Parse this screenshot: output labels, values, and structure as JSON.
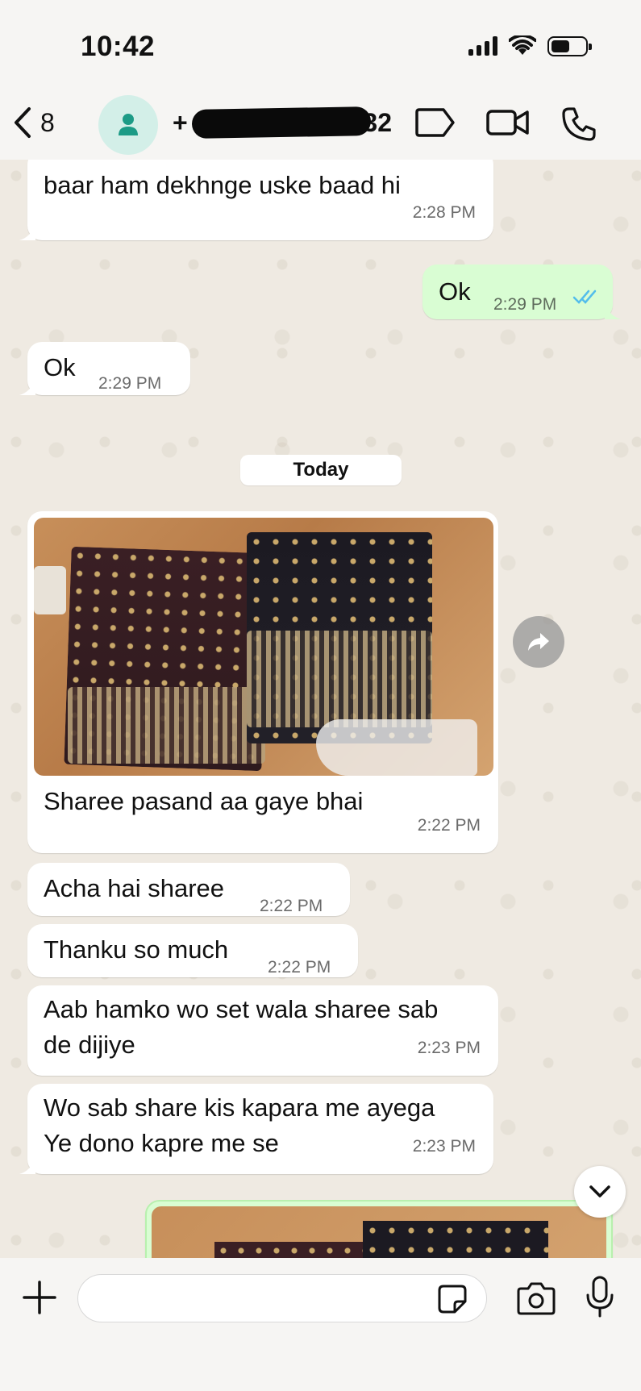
{
  "status": {
    "time": "10:42"
  },
  "header": {
    "back_count": "8",
    "contact_prefix": "+",
    "contact_suffix": "32"
  },
  "messages": [
    {
      "dir": "in",
      "text": "baar ham dekhnge uske baad hi",
      "time": "2:28 PM"
    },
    {
      "dir": "out",
      "text": "Ok",
      "time": "2:29 PM",
      "status": "read"
    },
    {
      "dir": "in",
      "text": "Ok",
      "time": "2:29 PM"
    },
    {
      "dir": "in",
      "text": "Sharee pasand aa gaye bhai",
      "time": "2:22 PM",
      "has_photo": true
    },
    {
      "dir": "in",
      "text": "Acha hai sharee",
      "time": "2:22 PM"
    },
    {
      "dir": "in",
      "text": "Thanku so much",
      "time": "2:22 PM"
    },
    {
      "dir": "in",
      "text_line1": "Aab hamko wo set wala sharee sab",
      "text_line2": "de dijiye",
      "time": "2:23 PM"
    },
    {
      "dir": "in",
      "text_line1": "Wo sab share kis kapara me ayega",
      "text_line2": "Ye dono kapre me se",
      "time": "2:23 PM"
    }
  ],
  "date_divider": "Today",
  "composer": {
    "placeholder": ""
  },
  "colors": {
    "incoming": "#ffffff",
    "outgoing": "#d9fdd3",
    "accent": "#1fa855",
    "read_ticks": "#53bdeb"
  }
}
